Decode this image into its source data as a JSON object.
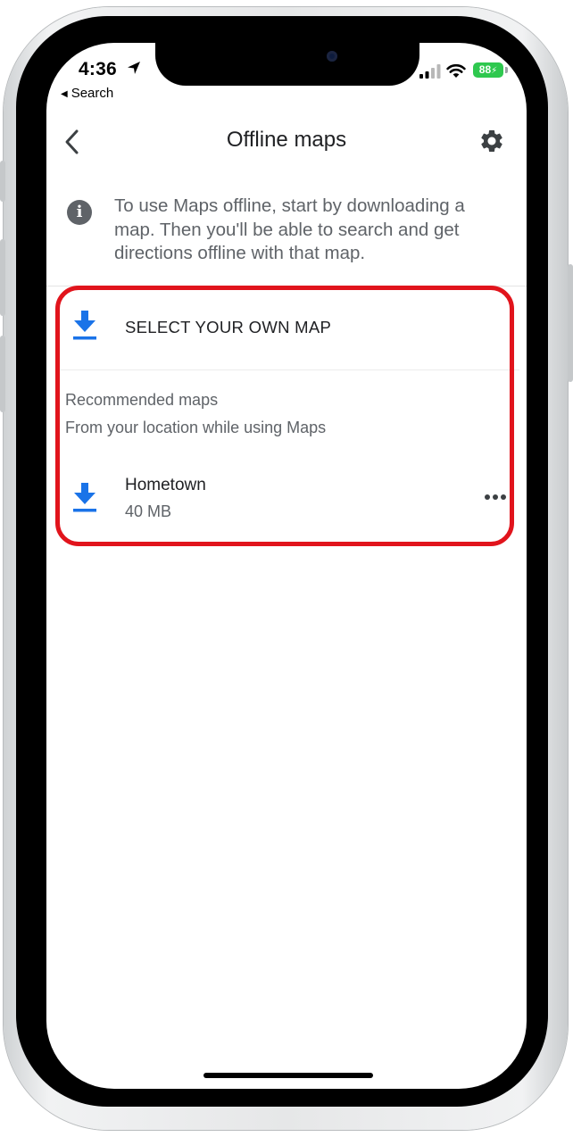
{
  "status_bar": {
    "time": "4:36",
    "back_app": "Search",
    "battery": "88"
  },
  "header": {
    "title": "Offline maps"
  },
  "info": {
    "text": "To use Maps offline, start by downloading a map. Then you'll be able to search and get directions offline with that map."
  },
  "select_own_map": {
    "label": "SELECT YOUR OWN MAP"
  },
  "recommended": {
    "title": "Recommended maps",
    "subtitle": "From your location while using Maps",
    "items": [
      {
        "name": "Hometown",
        "size": "40 MB"
      }
    ]
  },
  "colors": {
    "accent_blue": "#1a73e8",
    "highlight_red": "#e1141c",
    "battery_green": "#2fc84f"
  },
  "icons": [
    "back-chevron-icon",
    "gear-icon",
    "info-icon",
    "download-icon",
    "more-horizontal-icon",
    "location-arrow-icon",
    "signal-icon",
    "wifi-icon",
    "battery-icon"
  ]
}
